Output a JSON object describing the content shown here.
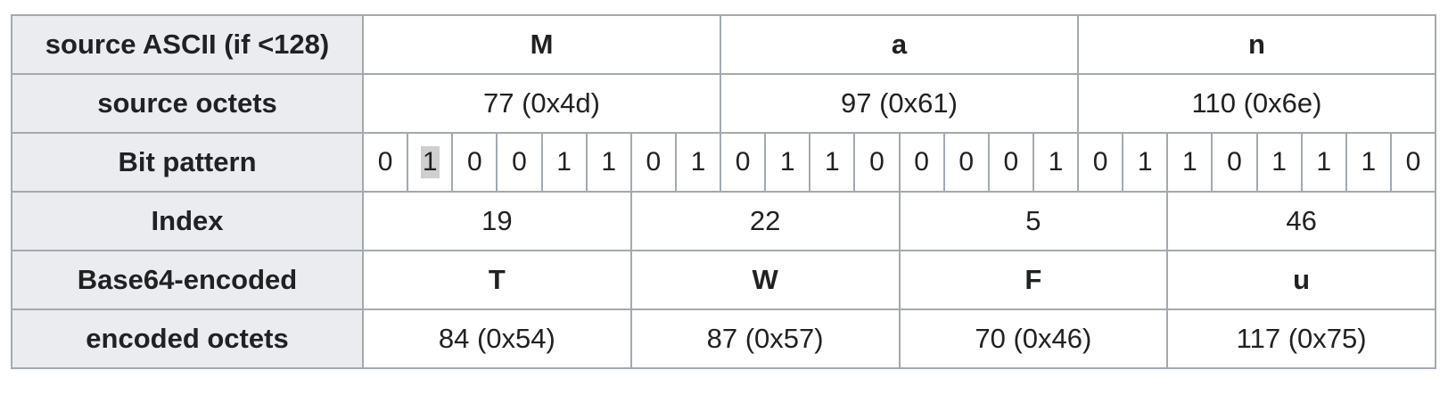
{
  "rows": {
    "source_ascii": {
      "label": "source ASCII (if <128)",
      "values": [
        "M",
        "a",
        "n"
      ]
    },
    "source_octets": {
      "label": "source octets",
      "values": [
        "77 (0x4d)",
        "97 (0x61)",
        "110 (0x6e)"
      ]
    },
    "bit_pattern": {
      "label": "Bit pattern",
      "bits": [
        "0",
        "1",
        "0",
        "0",
        "1",
        "1",
        "0",
        "1",
        "0",
        "1",
        "1",
        "0",
        "0",
        "0",
        "0",
        "1",
        "0",
        "1",
        "1",
        "0",
        "1",
        "1",
        "1",
        "0"
      ],
      "highlighted_bit_index": 1
    },
    "index": {
      "label": "Index",
      "values": [
        "19",
        "22",
        "5",
        "46"
      ]
    },
    "base64_encoded": {
      "label": "Base64-encoded",
      "values": [
        "T",
        "W",
        "F",
        "u"
      ]
    },
    "encoded_octets": {
      "label": "encoded octets",
      "values": [
        "84 (0x54)",
        "87 (0x57)",
        "70 (0x46)",
        "117 (0x75)"
      ]
    }
  },
  "colors": {
    "header_bg": "#eaecf0",
    "border": "#a2a9b1",
    "highlight": "#cfcfcf"
  }
}
